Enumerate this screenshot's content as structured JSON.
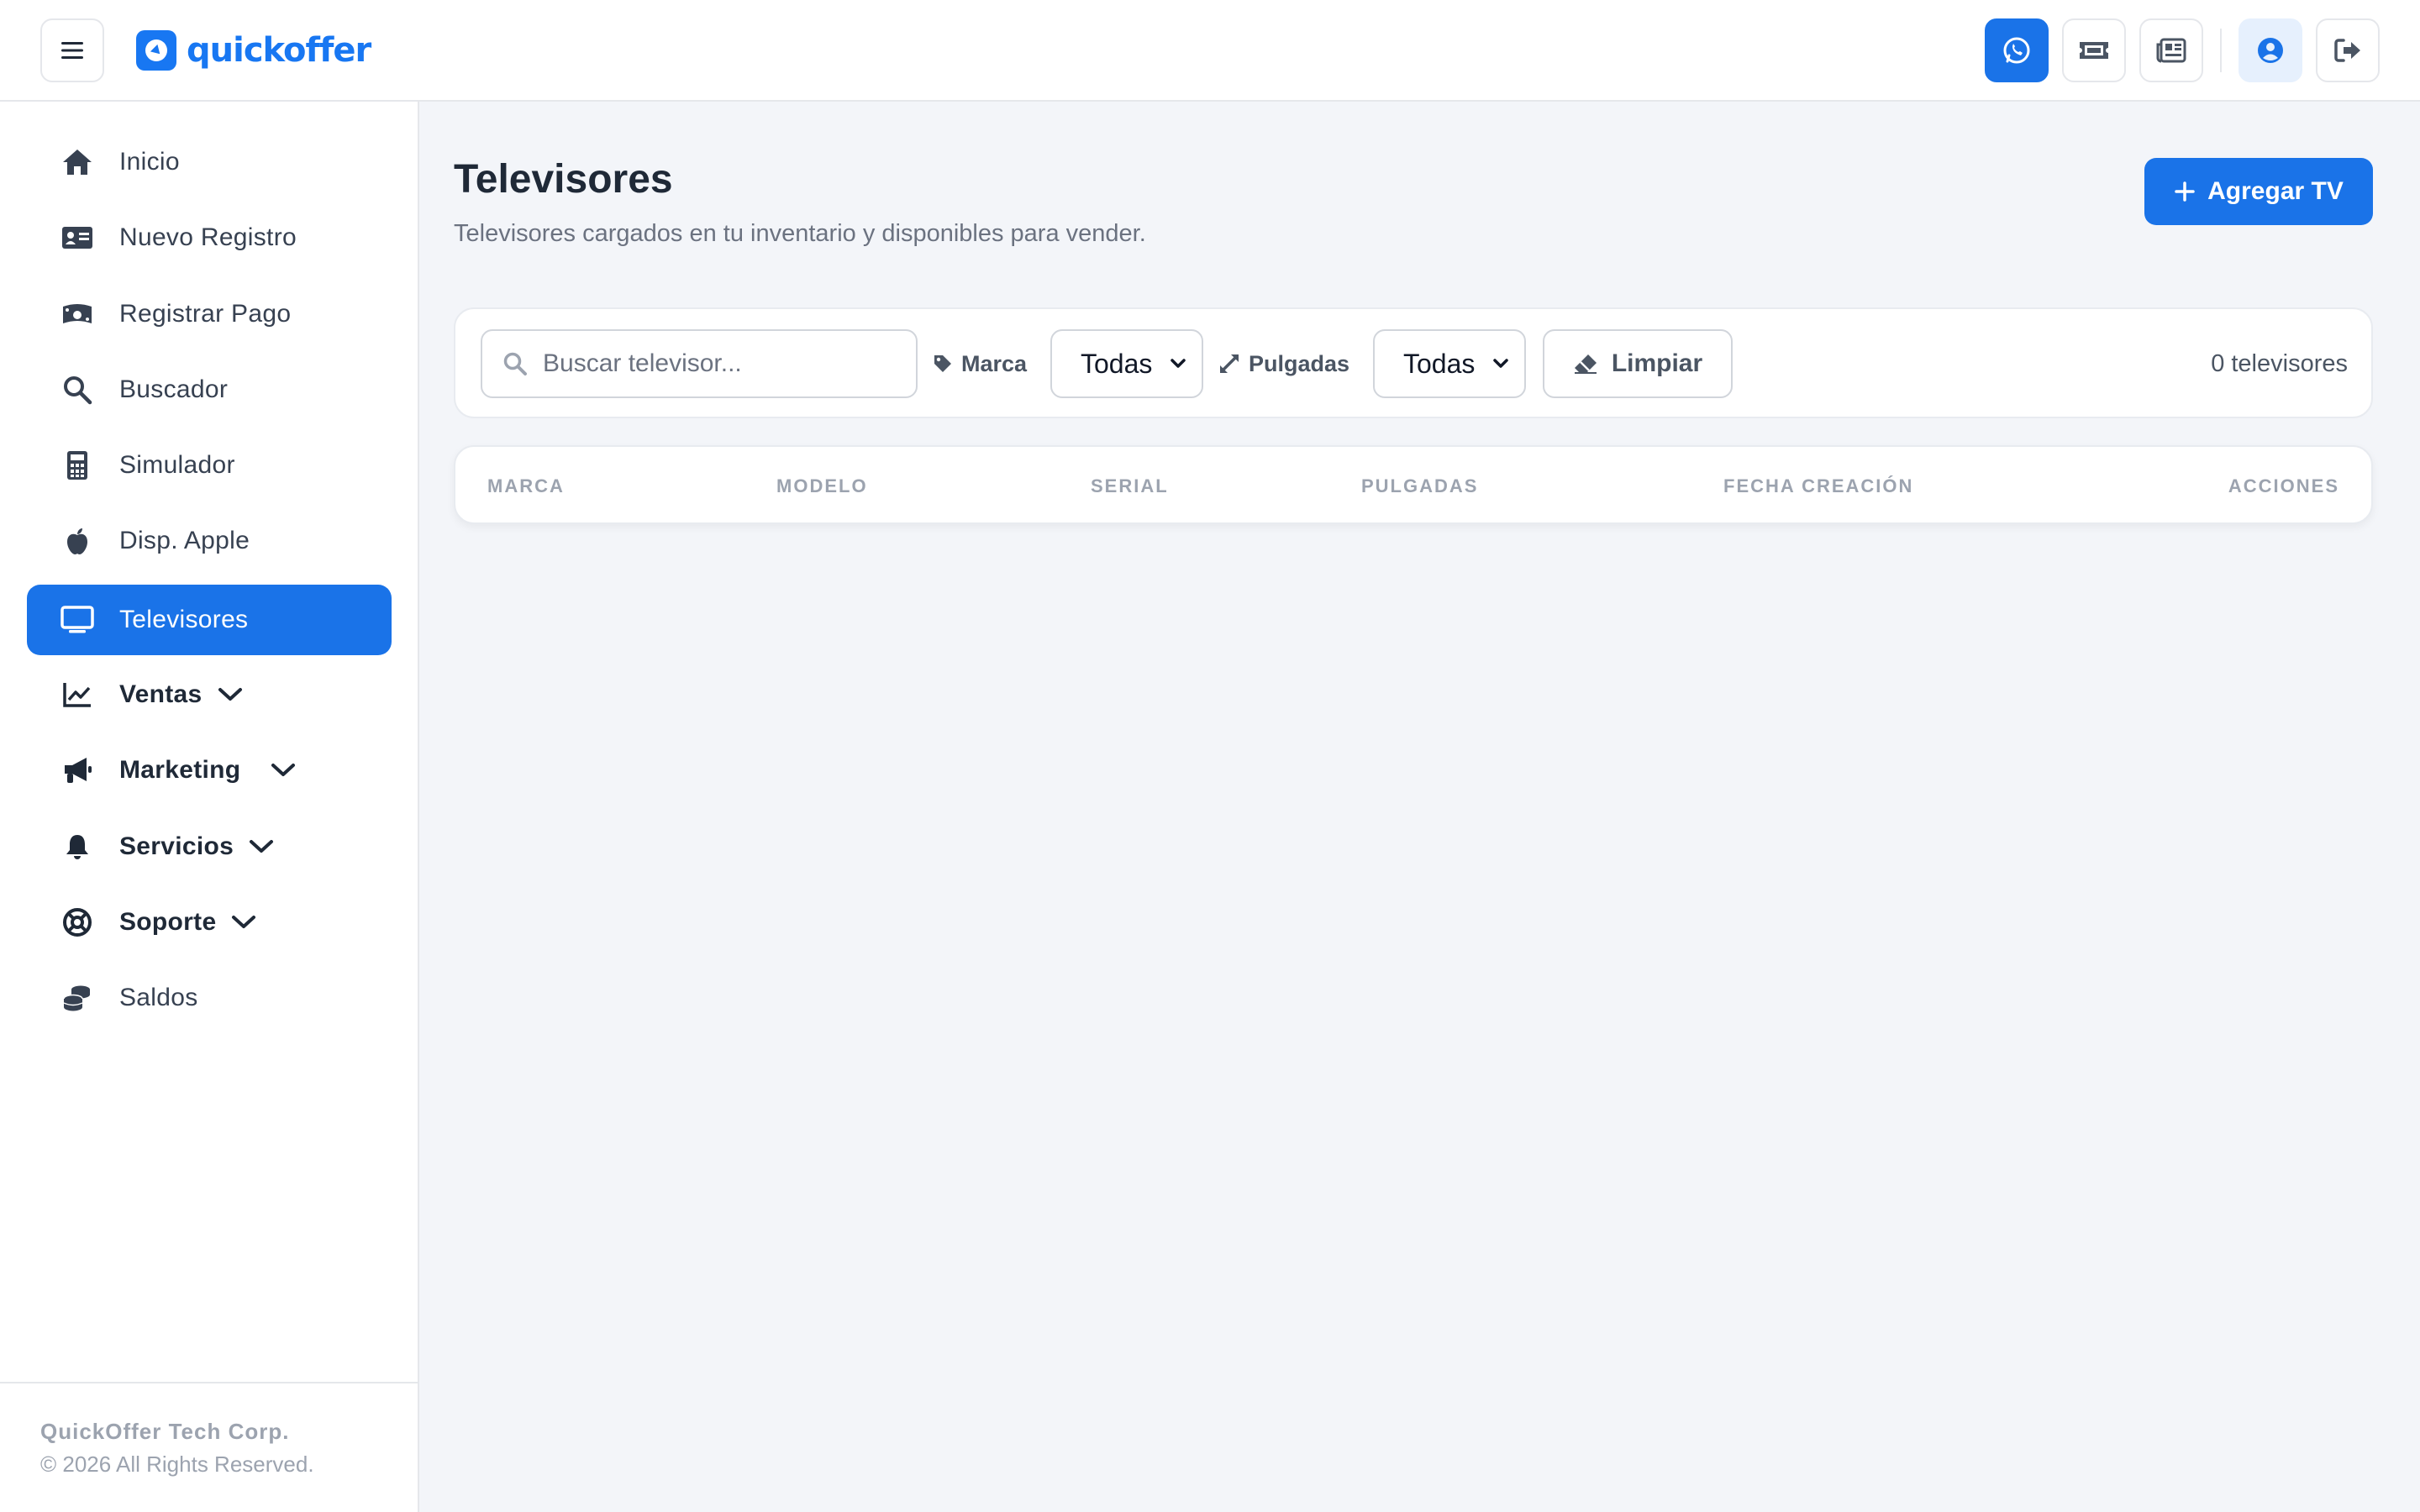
{
  "app": {
    "logo_text": "quickoffer"
  },
  "nav": {
    "items": [
      {
        "label": "Inicio"
      },
      {
        "label": "Nuevo Registro"
      },
      {
        "label": "Registrar Pago"
      },
      {
        "label": "Buscador"
      },
      {
        "label": "Simulador"
      },
      {
        "label": "Disp. Apple"
      },
      {
        "label": "Televisores"
      },
      {
        "label": "Ventas"
      },
      {
        "label": "Marketing"
      },
      {
        "label": "Servicios"
      },
      {
        "label": "Soporte"
      },
      {
        "label": "Saldos"
      }
    ],
    "active": "Televisores"
  },
  "footer": {
    "company": "QuickOffer Tech Corp.",
    "rights": "© 2026 All Rights Reserved."
  },
  "page": {
    "title": "Televisores",
    "subtitle": "Televisores cargados en tu inventario y disponibles para vender.",
    "add_button": "Agregar TV"
  },
  "filters": {
    "search_placeholder": "Buscar televisor...",
    "brand_label": "Marca",
    "brand_value": "Todas",
    "inches_label": "Pulgadas",
    "inches_value": "Todas",
    "clear_button": "Limpiar",
    "count_text": "0 televisores"
  },
  "table": {
    "columns": [
      "MARCA",
      "MODELO",
      "SERIAL",
      "PULGADAS",
      "FECHA CREACIÓN",
      "ACCIONES"
    ],
    "rows": []
  },
  "colors": {
    "accent": "#1a73e8",
    "background": "#f3f5f9",
    "surface": "#ffffff",
    "text_primary": "#1f2937",
    "text_muted": "#6b7280"
  }
}
